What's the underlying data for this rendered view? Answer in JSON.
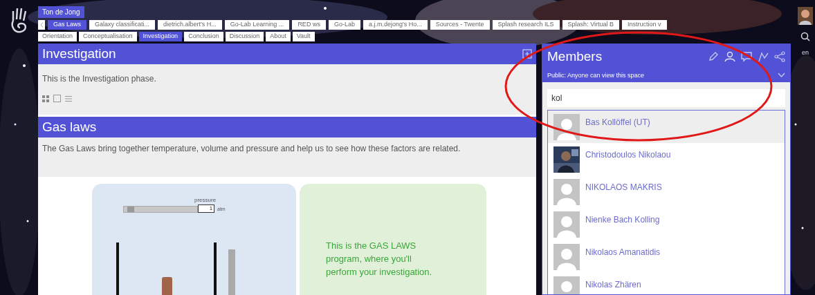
{
  "user_tab": {
    "label": "Ton de Jong"
  },
  "space_tabs": [
    {
      "label": "Gas Laws",
      "selected": true
    },
    {
      "label": "Galaxy classificati...",
      "selected": false
    },
    {
      "label": "dietrich.albert's H...",
      "selected": false
    },
    {
      "label": "Go-Lab Learning ...",
      "selected": false
    },
    {
      "label": "RED ws",
      "selected": false
    },
    {
      "label": "Go-Lab",
      "selected": false
    },
    {
      "label": "a.j.m.dejong's Ho...",
      "selected": false
    },
    {
      "label": "Sources - Twente",
      "selected": false
    },
    {
      "label": "Splash research ILS",
      "selected": false
    },
    {
      "label": "Splash: Virtual B",
      "selected": false
    },
    {
      "label": "Instruction v",
      "selected": false
    }
  ],
  "phase_tabs": [
    {
      "label": "Orientation",
      "selected": false
    },
    {
      "label": "Conceptualisation",
      "selected": false
    },
    {
      "label": "Investigation",
      "selected": true
    },
    {
      "label": "Conclusion",
      "selected": false
    },
    {
      "label": "Discussion",
      "selected": false
    },
    {
      "label": "About",
      "selected": false
    },
    {
      "label": "Vault",
      "selected": false
    }
  ],
  "phase": {
    "title": "Investigation",
    "description": "This is the Investigation phase."
  },
  "resource": {
    "title": "Gas laws",
    "description": "The Gas Laws bring together temperature, volume and pressure and help us to see how these factors are related.",
    "simulation": {
      "slider_label": "pressure",
      "level": 0.05,
      "value": "1",
      "unit": "atm",
      "intro": "This is the GAS LAWS program, where you'll perform your investigation."
    }
  },
  "members": {
    "title": "Members",
    "visibility": "Public: Anyone can view this space",
    "search": "kol",
    "results": [
      {
        "name": "Bas Kollöffel (UT)",
        "selected": true,
        "kind": "default"
      },
      {
        "name": "Christodoulos Nikolaou",
        "selected": false
      },
      {
        "name": "NIKOLAOS MAKRIS",
        "selected": false,
        "kind": "default"
      },
      {
        "name": "Nienke Bach Kolling",
        "selected": false,
        "kind": "default"
      },
      {
        "name": "Nikolaos Amanatidis",
        "selected": false,
        "kind": "default"
      },
      {
        "name": "Nikolas Zhären",
        "selected": false,
        "kind": "default"
      }
    ]
  },
  "language": "en"
}
